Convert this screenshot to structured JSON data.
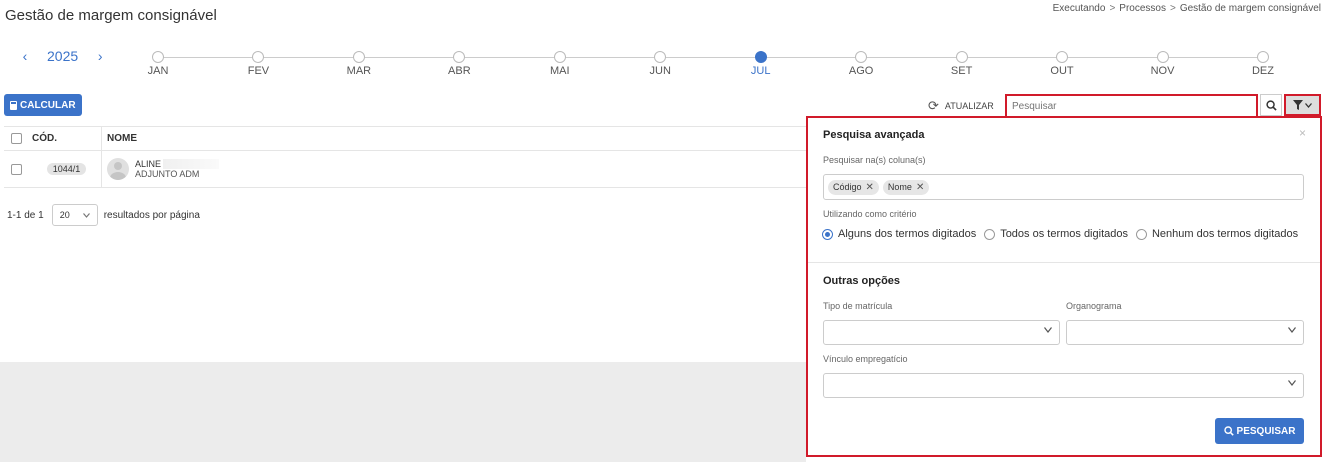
{
  "page": {
    "title": "Gestão de margem consignável"
  },
  "breadcrumb": [
    "Executando",
    "Processos",
    "Gestão de margem consignável"
  ],
  "breadcrumb_separator": ">",
  "year_nav": {
    "prev_icon": "‹",
    "next_icon": "›",
    "year": "2025"
  },
  "months": [
    {
      "label": "JAN",
      "active": false
    },
    {
      "label": "FEV",
      "active": false
    },
    {
      "label": "MAR",
      "active": false
    },
    {
      "label": "ABR",
      "active": false
    },
    {
      "label": "MAI",
      "active": false
    },
    {
      "label": "JUN",
      "active": false
    },
    {
      "label": "JUL",
      "active": true
    },
    {
      "label": "AGO",
      "active": false
    },
    {
      "label": "SET",
      "active": false
    },
    {
      "label": "OUT",
      "active": false
    },
    {
      "label": "NOV",
      "active": false
    },
    {
      "label": "DEZ",
      "active": false
    }
  ],
  "toolbar": {
    "calc_label": "CALCULAR",
    "refresh_label": "ATUALIZAR",
    "refresh_icon": "⟳",
    "search_placeholder": "Pesquisar"
  },
  "table": {
    "col_code": "CÓD.",
    "col_name": "NOME",
    "rows": [
      {
        "code": "1044/1",
        "name": "ALINE",
        "role": "ADJUNTO ADM"
      }
    ]
  },
  "pagination": {
    "range": "1-1 de 1",
    "per_page": "20",
    "per_page_label": "resultados por página"
  },
  "advanced_search": {
    "title": "Pesquisa avançada",
    "close_icon": "×",
    "columns_label": "Pesquisar na(s) coluna(s)",
    "chips": [
      "Código",
      "Nome"
    ],
    "chip_remove": "✕",
    "criteria_label": "Utilizando como critério",
    "criteria": [
      {
        "label": "Alguns dos termos digitados",
        "selected": true
      },
      {
        "label": "Todos os termos digitados",
        "selected": false
      },
      {
        "label": "Nenhum dos termos digitados",
        "selected": false
      }
    ],
    "other_title": "Outras opções",
    "tipo_matricula_label": "Tipo de matrícula",
    "organograma_label": "Organograma",
    "vinculo_label": "Vínculo empregatício",
    "submit_label": "PESQUISAR"
  },
  "colors": {
    "primary": "#3b73c9",
    "highlight_border": "#d11a2a"
  },
  "icons": {
    "calc": "calculator-icon",
    "refresh": "refresh-icon",
    "search": "search-icon",
    "filter": "filter-icon",
    "chevron": "chevron-down-icon"
  }
}
